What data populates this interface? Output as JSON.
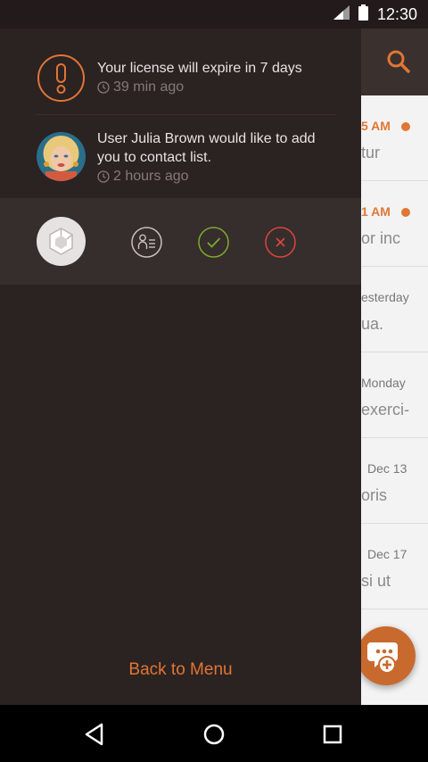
{
  "status_bar": {
    "time": "12:30"
  },
  "background_list": {
    "rows": [
      {
        "time": "5 AM",
        "snippet": "tur",
        "unread": true
      },
      {
        "time": "1 AM",
        "snippet": "or inc",
        "unread": true
      },
      {
        "time": "esterday",
        "snippet": "ua.",
        "unread": false
      },
      {
        "time": "Monday",
        "snippet": "exerci-",
        "unread": false
      },
      {
        "time": "Dec 13",
        "snippet": "oris",
        "unread": false
      },
      {
        "time": "Dec 17",
        "snippet": "si ut",
        "unread": false
      }
    ]
  },
  "drawer": {
    "notifications": [
      {
        "text": "Your license will expire in 7 days",
        "time": "39 min ago"
      },
      {
        "text": "User Julia Brown would like to add you to contact list.",
        "time": "2 hours ago"
      }
    ],
    "back_label": "Back to Menu"
  },
  "colors": {
    "accent": "#e07634",
    "accept": "#7cab2c",
    "reject": "#d9463c",
    "drawer_bg": "#2b2222"
  }
}
